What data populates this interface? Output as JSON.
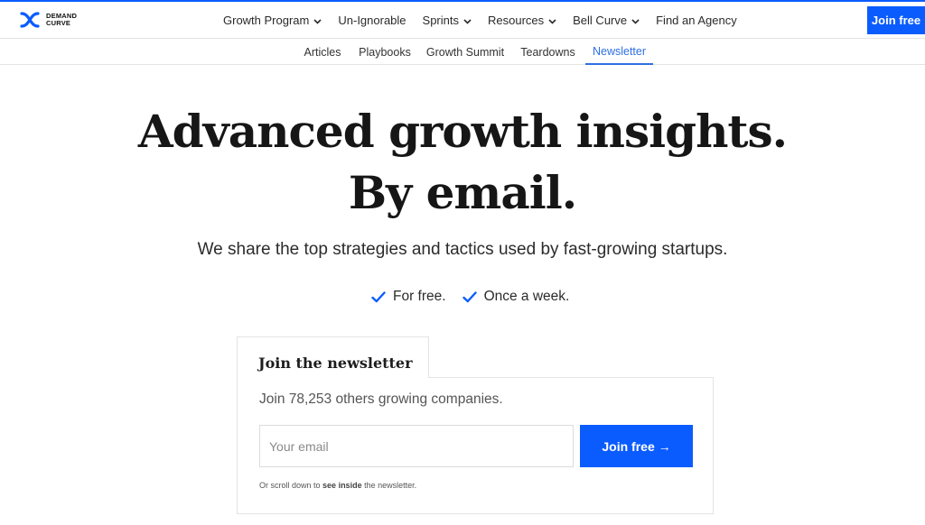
{
  "brand": {
    "logo_line1": "DEMAND",
    "logo_line2": "CURVE",
    "accent": "#0b5cff"
  },
  "topnav": {
    "items": [
      {
        "label": "Growth Program",
        "dropdown": true
      },
      {
        "label": "Un-Ignorable",
        "dropdown": false
      },
      {
        "label": "Sprints",
        "dropdown": true
      },
      {
        "label": "Resources",
        "dropdown": true
      },
      {
        "label": "Bell Curve",
        "dropdown": true
      },
      {
        "label": "Find an Agency",
        "dropdown": false
      }
    ],
    "cta_label": "Join free"
  },
  "subnav": {
    "items": [
      "Articles",
      "Playbooks",
      "Growth Summit",
      "Teardowns",
      "Newsletter"
    ],
    "active": "Newsletter"
  },
  "hero": {
    "title_line1": "Advanced growth insights.",
    "title_line2": "By email.",
    "subtitle": "We share the top strategies and tactics used by fast-growing startups.",
    "checks": [
      "For free.",
      "Once a week."
    ]
  },
  "signup": {
    "tab_title": "Join the newsletter",
    "subtitle": "Join 78,253 others growing companies.",
    "email_placeholder": "Your email",
    "button_label": "Join free →",
    "footnote_before": "Or scroll down to",
    "footnote_bold": "see inside",
    "footnote_after": "the newsletter."
  }
}
